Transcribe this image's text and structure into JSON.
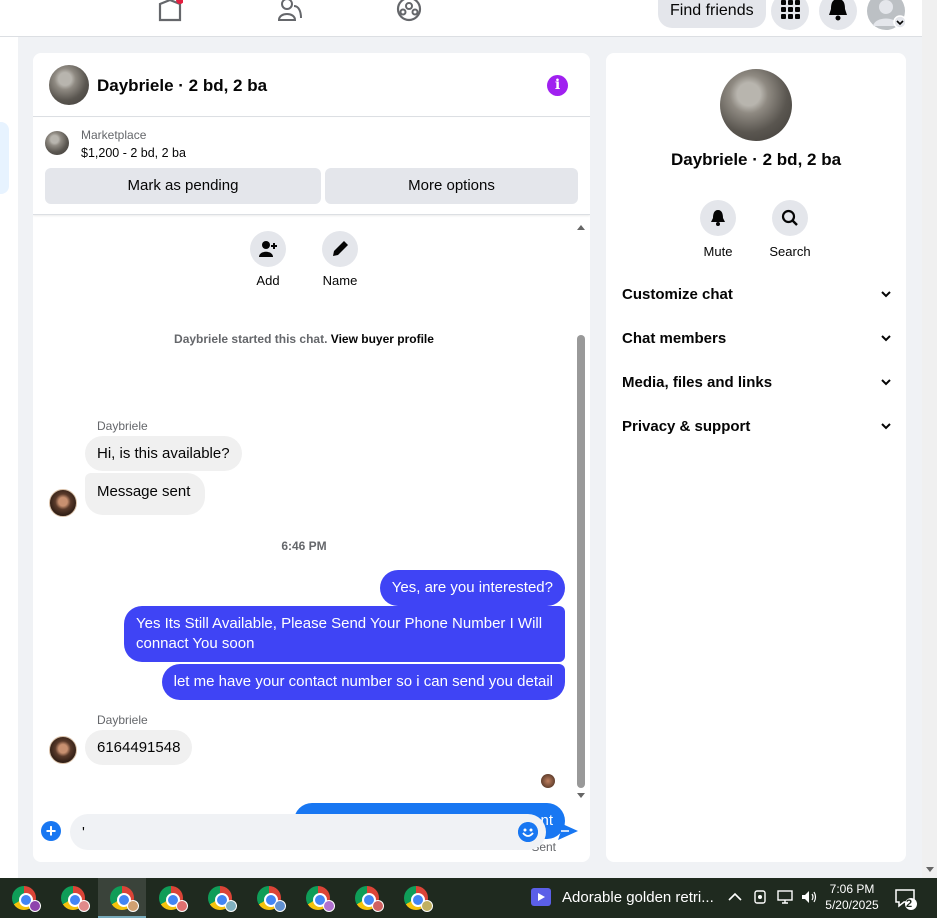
{
  "chat": {
    "title": "Daybriele · 2 bd, 2 ba",
    "marketplace_label": "Marketplace",
    "listing": "$1,200 - 2 bd, 2 ba",
    "mark_pending": "Mark as pending",
    "more_options": "More options",
    "actions": {
      "add": "Add",
      "name": "Name"
    },
    "system_prefix": "Daybriele started this chat.",
    "system_link": "View buyer profile",
    "messages": [
      {
        "from": "Daybriele",
        "sender_label": "Daybriele",
        "text": "Hi, is this available?"
      },
      {
        "from": "Daybriele",
        "text": "Message sent"
      },
      {
        "from": "me",
        "text": "Yes, are you interested?"
      },
      {
        "from": "me",
        "text": "Yes Its Still Available, Please Send Your Phone Number I Will connact You soon"
      },
      {
        "from": "me",
        "text": "let me have your contact number so i can send you detail"
      },
      {
        "from": "Daybriele",
        "sender_label": "Daybriele",
        "text": "6164491548"
      },
      {
        "from": "me",
        "text": "Thanks I'll message you in a moment"
      }
    ],
    "timestamp": "6:46 PM",
    "sent_status": "Sent",
    "composer_value": "'"
  },
  "nav": {
    "find_friends": "Find friends"
  },
  "info_panel": {
    "name": "Daybriele · 2 bd, 2 ba",
    "mute": "Mute",
    "search": "Search",
    "sections": [
      "Customize chat",
      "Chat members",
      "Media, files and links",
      "Privacy & support"
    ]
  },
  "taskbar": {
    "media_title": "Adorable golden retri...",
    "time": "7:06 PM",
    "date": "5/20/2025",
    "notifications": "2"
  },
  "colors": {
    "outgoing_bubble": "#3f44f5",
    "last_outgoing_bubble": "#1877f2",
    "info_icon": "#a020f0"
  }
}
